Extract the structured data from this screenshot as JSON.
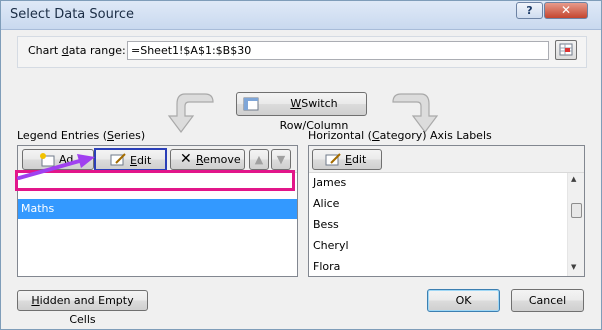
{
  "window": {
    "title": "Select Data Source",
    "help": "?",
    "close": "✕"
  },
  "range": {
    "label_pre": "Chart ",
    "label_u": "d",
    "label_post": "ata range:",
    "value": "=Sheet1!$A$1:$B$30"
  },
  "switch": {
    "label_u": "W",
    "label_post": "Switch Row/Column"
  },
  "legend": {
    "title_pre": "Legend Entries (",
    "title_u": "S",
    "title_post": "eries)",
    "add": "Ad",
    "edit_u": "E",
    "edit_post": "dit",
    "remove_u": "R",
    "remove_post": "emove",
    "items": [
      {
        "label": "Maths"
      }
    ]
  },
  "axis": {
    "title_pre": "Horizontal (",
    "title_u": "C",
    "title_post": "ategory) Axis Labels",
    "edit_u": "E",
    "edit_post": "dit",
    "items": [
      {
        "label": "James"
      },
      {
        "label": "Alice"
      },
      {
        "label": "Bess"
      },
      {
        "label": "Cheryl"
      },
      {
        "label": "Flora"
      }
    ]
  },
  "footer": {
    "hidden_u": "H",
    "hidden_post": "idden and Empty Cells",
    "ok": "OK",
    "cancel": "Cancel"
  },
  "colors": {
    "selection": "#3399ff",
    "highlight_pink": "#e2168a",
    "highlight_blue": "#2b3fb8",
    "arrow_purple": "#a040f0"
  }
}
